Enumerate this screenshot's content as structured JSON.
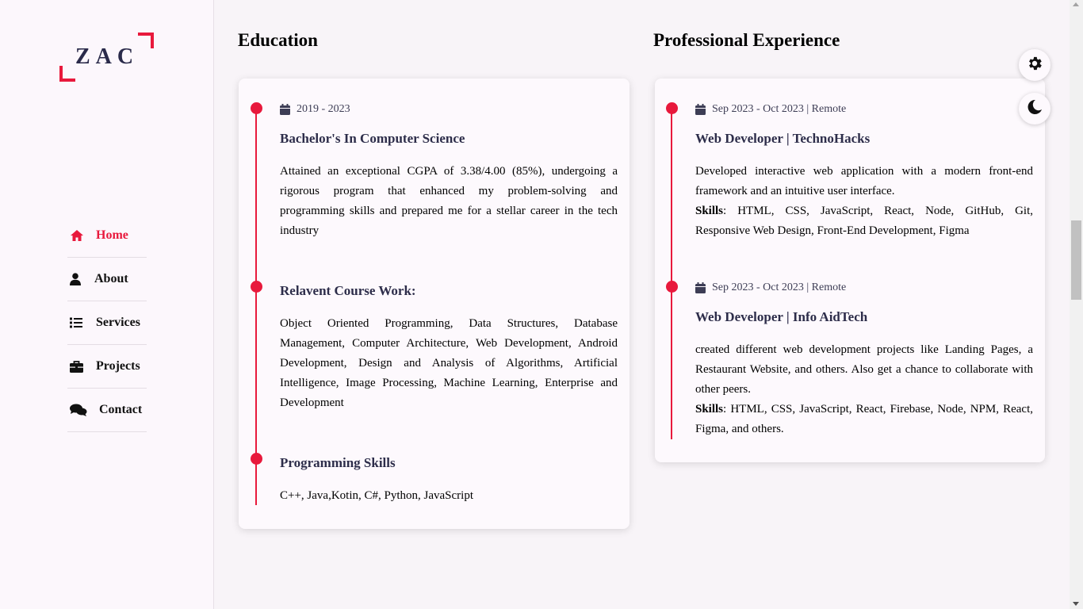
{
  "brand": {
    "logo_text": "ZAC"
  },
  "nav": [
    {
      "label": "Home",
      "icon": "home-icon",
      "active": true
    },
    {
      "label": "About",
      "icon": "user-icon",
      "active": false
    },
    {
      "label": "Services",
      "icon": "list-icon",
      "active": false
    },
    {
      "label": "Projects",
      "icon": "briefcase-icon",
      "active": false
    },
    {
      "label": "Contact",
      "icon": "comments-icon",
      "active": false
    }
  ],
  "education": {
    "title": "Education",
    "entries": [
      {
        "date": "2019 - 2023",
        "title": "Bachelor's In Computer Science",
        "text": "Attained an exceptional CGPA of 3.38/4.00 (85%), undergoing a rigorous program that enhanced my problem-solving and programming skills and prepared me for a stellar career in the tech industry"
      },
      {
        "title": "Relavent Course Work:",
        "text": "Object Oriented Programming, Data Structures, Database Management, Computer Architecture, Web Development, Android Development, Design and Analysis of Algorithms, Artificial Intelligence, Image Processing, Machine Learning, Enterprise and Development"
      },
      {
        "title": "Programming Skills",
        "text": "C++, Java,Kotin, C#, Python, JavaScript"
      }
    ]
  },
  "experience": {
    "title": "Professional Experience",
    "entries": [
      {
        "date": "Sep 2023 - Oct 2023 | Remote",
        "title": "Web Developer | TechnoHacks",
        "text": "Developed interactive web application with a modern front-end framework and an intuitive user interface.",
        "skills_label": "Skills",
        "skills": ": HTML, CSS, JavaScript, React, Node, GitHub, Git, Responsive Web Design, Front-End Development, Figma"
      },
      {
        "date": "Sep 2023 - Oct 2023 | Remote",
        "title": "Web Developer | Info AidTech",
        "text": "created different web development projects like Landing Pages, a Restaurant Website, and others. Also get a chance to collaborate with other peers.",
        "skills_label": "Skills",
        "skills": ": HTML, CSS, JavaScript, React, Firebase, Node, NPM, React, Figma, and others."
      }
    ]
  },
  "colors": {
    "accent": "#e8193c",
    "title_text": "#2d2d4a",
    "background": "#f8f4f8"
  },
  "floating": {
    "settings_icon": "gear-icon",
    "theme_icon": "moon-icon"
  }
}
